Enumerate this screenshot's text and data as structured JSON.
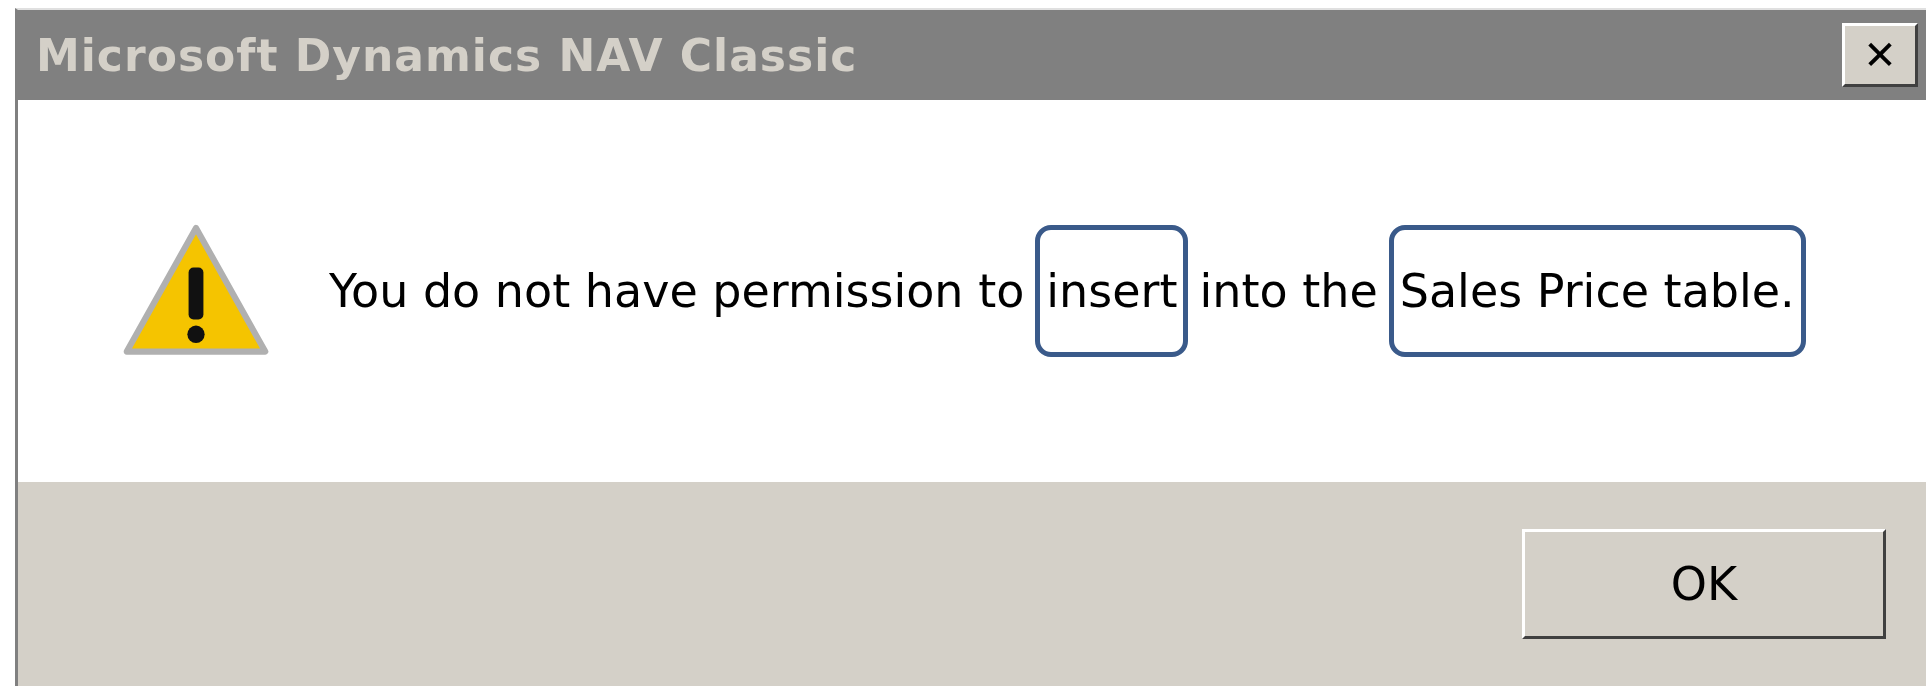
{
  "window": {
    "title": "Microsoft Dynamics NAV Classic",
    "close_label": "✕"
  },
  "message": {
    "segments": [
      {
        "text": "You do not have permission to",
        "highlighted": false
      },
      {
        "text": "insert",
        "highlighted": true
      },
      {
        "text": "into the",
        "highlighted": false
      },
      {
        "text": "Sales Price table.",
        "highlighted": true
      }
    ]
  },
  "buttons": [
    {
      "label": "OK"
    }
  ]
}
